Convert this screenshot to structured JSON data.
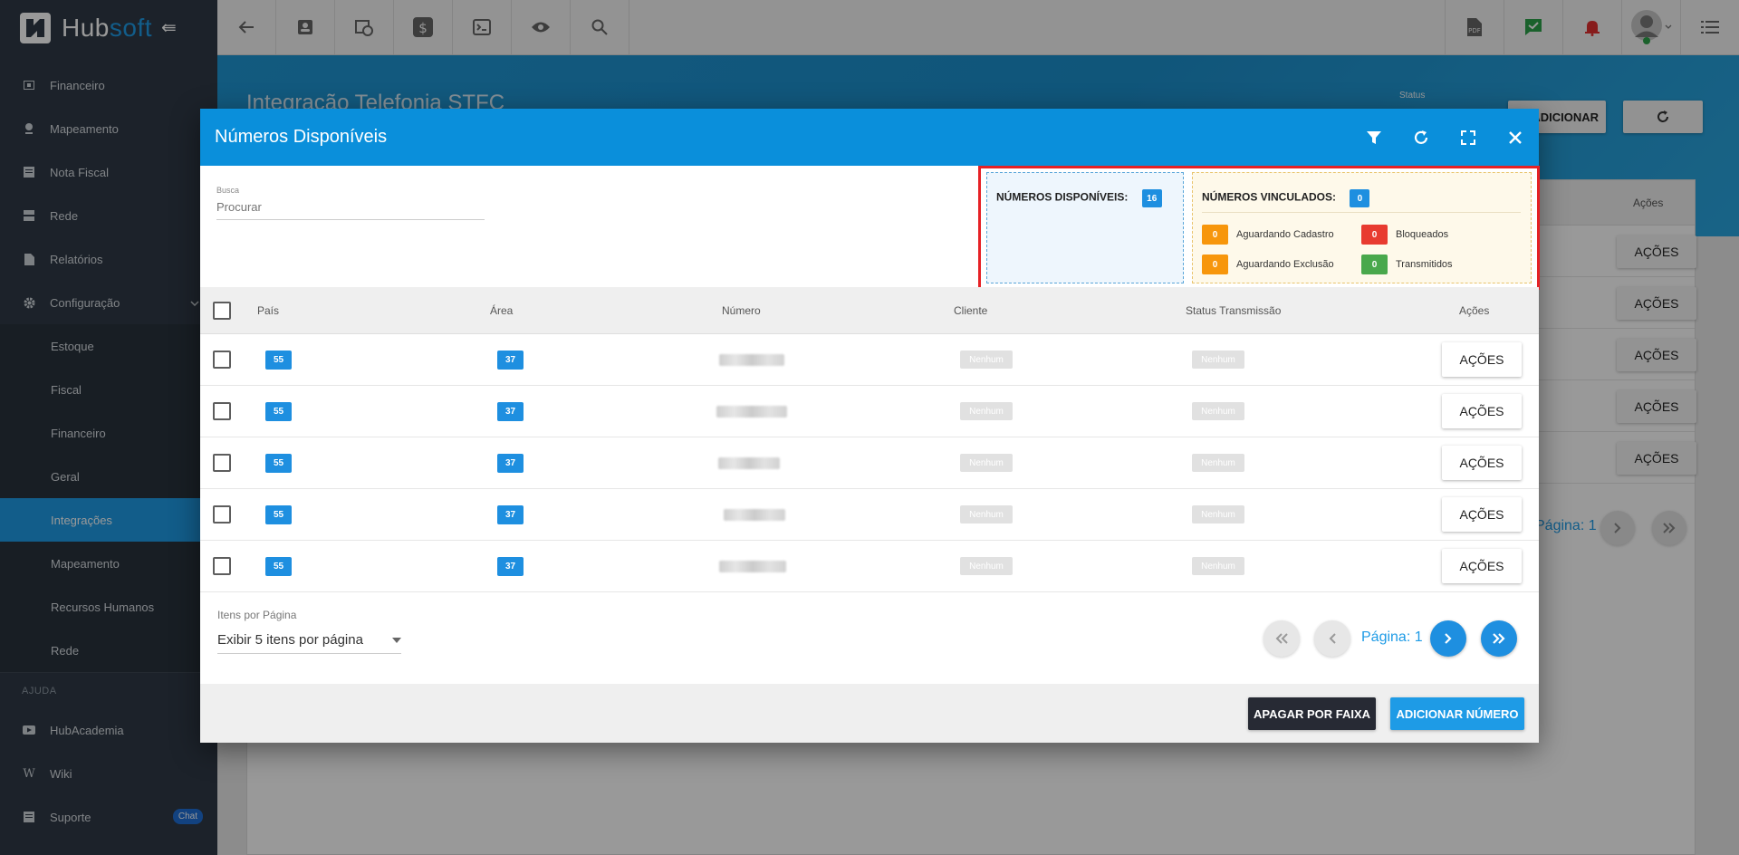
{
  "app": {
    "logo_main": "Hub",
    "logo_accent": "soft"
  },
  "sidebar": {
    "items": [
      {
        "label": "Financeiro",
        "icon": "wallet-icon"
      },
      {
        "label": "Mapeamento",
        "icon": "map-pin-icon"
      },
      {
        "label": "Nota Fiscal",
        "icon": "invoice-icon"
      },
      {
        "label": "Rede",
        "icon": "server-icon"
      },
      {
        "label": "Relatórios",
        "icon": "report-icon"
      },
      {
        "label": "Configuração",
        "icon": "gear-icon"
      }
    ],
    "sub_items": [
      {
        "label": "Estoque"
      },
      {
        "label": "Fiscal"
      },
      {
        "label": "Financeiro"
      },
      {
        "label": "Geral"
      },
      {
        "label": "Integrações",
        "active": true
      },
      {
        "label": "Mapeamento"
      },
      {
        "label": "Recursos Humanos"
      },
      {
        "label": "Rede"
      }
    ],
    "section_help": "AJUDA",
    "help_items": [
      {
        "label": "HubAcademia",
        "icon": "youtube-icon"
      },
      {
        "label": "Wiki",
        "icon": "wikipedia-icon"
      },
      {
        "label": "Suporte",
        "icon": "support-icon",
        "badge": "Chat"
      }
    ]
  },
  "background_page": {
    "title": "Integração Telefonia STFC",
    "status_label": "Status",
    "add_button": "ADICIONAR",
    "table_header_actions": "Ações",
    "row_action": "AÇÕES",
    "pagination_label": "Página: 1"
  },
  "modal": {
    "title": "Números Disponíveis",
    "search": {
      "label": "Busca",
      "placeholder": "Procurar"
    },
    "counters": {
      "available_label": "NÚMEROS DISPONÍVEIS:",
      "available_count": "16",
      "linked_label": "NÚMEROS VINCULADOS:",
      "linked_count": "0",
      "statuses": [
        {
          "label": "Aguardando Cadastro",
          "count": "0",
          "color": "#f7960b"
        },
        {
          "label": "Bloqueados",
          "count": "0",
          "color": "#e83b30"
        },
        {
          "label": "Aguardando Exclusão",
          "count": "0",
          "color": "#f7960b"
        },
        {
          "label": "Transmitidos",
          "count": "0",
          "color": "#49a84c"
        }
      ]
    },
    "table": {
      "columns": [
        "País",
        "Área",
        "Número",
        "Cliente",
        "Status Transmissão",
        "Ações"
      ],
      "rows": [
        {
          "pais": "55",
          "area": "37",
          "cliente": "Nenhum",
          "status": "Nenhum",
          "action": "AÇÕES"
        },
        {
          "pais": "55",
          "area": "37",
          "cliente": "Nenhum",
          "status": "Nenhum",
          "action": "AÇÕES"
        },
        {
          "pais": "55",
          "area": "37",
          "cliente": "Nenhum",
          "status": "Nenhum",
          "action": "AÇÕES"
        },
        {
          "pais": "55",
          "area": "37",
          "cliente": "Nenhum",
          "status": "Nenhum",
          "action": "AÇÕES"
        },
        {
          "pais": "55",
          "area": "37",
          "cliente": "Nenhum",
          "status": "Nenhum",
          "action": "AÇÕES"
        }
      ]
    },
    "items_per_page": {
      "label": "Itens por Página",
      "value": "Exibir 5 itens por página"
    },
    "pagination": {
      "label": "Página: 1"
    },
    "footer": {
      "delete_range": "APAGAR POR FAIXA",
      "add_number": "ADICIONAR NÚMERO"
    }
  },
  "colors": {
    "primary": "#1e9be6",
    "sidebar_bg": "#2f3a46",
    "highlight_border": "#e62125"
  }
}
